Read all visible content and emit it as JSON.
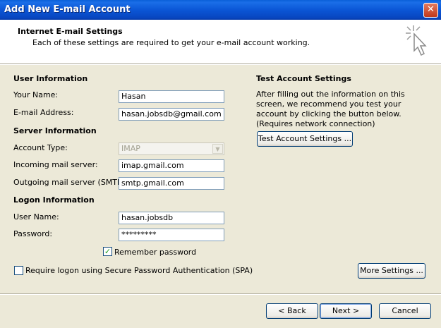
{
  "window": {
    "title": "Add New E-mail Account",
    "close_glyph": "✕"
  },
  "header": {
    "title": "Internet E-mail Settings",
    "subtitle": "Each of these settings are required to get your e-mail account working.",
    "icon": "cursor-sparkle-icon"
  },
  "user_info": {
    "heading": "User Information",
    "name_label": "Your Name:",
    "name_value": "Hasan",
    "email_label": "E-mail Address:",
    "email_value": "hasan.jobsdb@gmail.com"
  },
  "server_info": {
    "heading": "Server Information",
    "account_type_label": "Account Type:",
    "account_type_value": "IMAP",
    "incoming_label": "Incoming mail server:",
    "incoming_value": "imap.gmail.com",
    "outgoing_label": "Outgoing mail server (SMTP):",
    "outgoing_value": "smtp.gmail.com"
  },
  "logon_info": {
    "heading": "Logon Information",
    "username_label": "User Name:",
    "username_value": "hasan.jobsdb",
    "password_label": "Password:",
    "password_value": "*********",
    "remember_label": "Remember password",
    "remember_checked": true,
    "spa_label": "Require logon using Secure Password Authentication (SPA)",
    "spa_checked": false
  },
  "test_settings": {
    "heading": "Test Account Settings",
    "description": "After filling out the information on this screen, we recommend you test your account by clicking the button below. (Requires network connection)",
    "button_label": "Test Account Settings ..."
  },
  "buttons": {
    "more_settings": "More Settings ...",
    "back": "< Back",
    "next": "Next >",
    "cancel": "Cancel"
  },
  "colors": {
    "title_bar": "#0b56d6",
    "dialog_bg": "#ece9d8",
    "field_border": "#7f9db9"
  }
}
